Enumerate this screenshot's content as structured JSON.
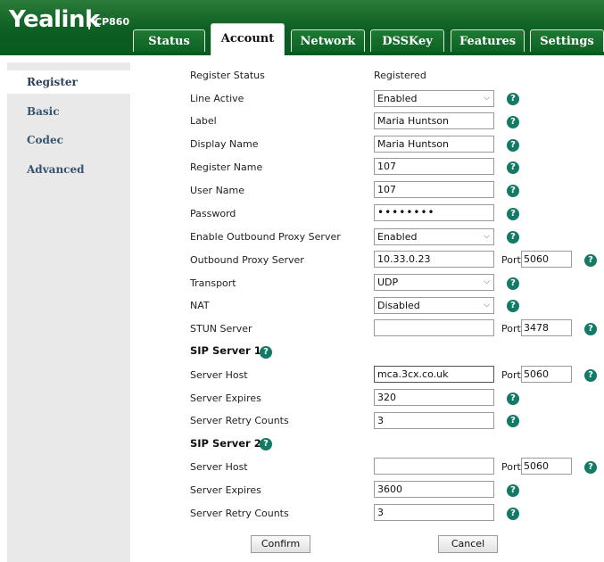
{
  "header": {
    "logo": "Yealink",
    "model": "CP860",
    "tabs": [
      "Status",
      "Account",
      "Network",
      "DSSKey",
      "Features",
      "Settings"
    ],
    "active_tab": "Account"
  },
  "sidebar": {
    "items": [
      "Register",
      "Basic",
      "Codec",
      "Advanced"
    ],
    "active": "Register"
  },
  "form": {
    "register_status": {
      "label": "Register Status",
      "value": "Registered"
    },
    "line_active": {
      "label": "Line Active",
      "value": "Enabled"
    },
    "label": {
      "label": "Label",
      "value": "Maria Huntson"
    },
    "display_name": {
      "label": "Display Name",
      "value": "Maria Huntson"
    },
    "register_name": {
      "label": "Register Name",
      "value": "107"
    },
    "user_name": {
      "label": "User Name",
      "value": "107"
    },
    "password": {
      "label": "Password",
      "value": "••••••••"
    },
    "enable_outbound_proxy": {
      "label": "Enable Outbound Proxy Server",
      "value": "Enabled"
    },
    "outbound_proxy_server": {
      "label": "Outbound Proxy Server",
      "value": "10.33.0.23",
      "port_label": "Port",
      "port": "5060"
    },
    "transport": {
      "label": "Transport",
      "value": "UDP"
    },
    "nat": {
      "label": "NAT",
      "value": "Disabled"
    },
    "stun_server": {
      "label": "STUN Server",
      "value": "",
      "port_label": "Port",
      "port": "3478"
    },
    "sip_server_1": {
      "title": "SIP Server 1",
      "server_host": {
        "label": "Server Host",
        "value": "mca.3cx.co.uk",
        "port_label": "Port",
        "port": "5060"
      },
      "server_expires": {
        "label": "Server Expires",
        "value": "320"
      },
      "server_retry_counts": {
        "label": "Server Retry Counts",
        "value": "3"
      }
    },
    "sip_server_2": {
      "title": "SIP Server 2",
      "server_host": {
        "label": "Server Host",
        "value": "",
        "port_label": "Port",
        "port": "5060"
      },
      "server_expires": {
        "label": "Server Expires",
        "value": "3600"
      },
      "server_retry_counts": {
        "label": "Server Retry Counts",
        "value": "3"
      }
    }
  },
  "help_icon_glyph": "?",
  "dropdown_chevron_glyph": "⌵",
  "buttons": {
    "confirm": "Confirm",
    "cancel": "Cancel"
  },
  "colors": {
    "header_green": "#0d5e22",
    "help_teal": "#137a66",
    "sidebar_bg": "#e9e9e9",
    "sidebar_text": "#36536f"
  }
}
